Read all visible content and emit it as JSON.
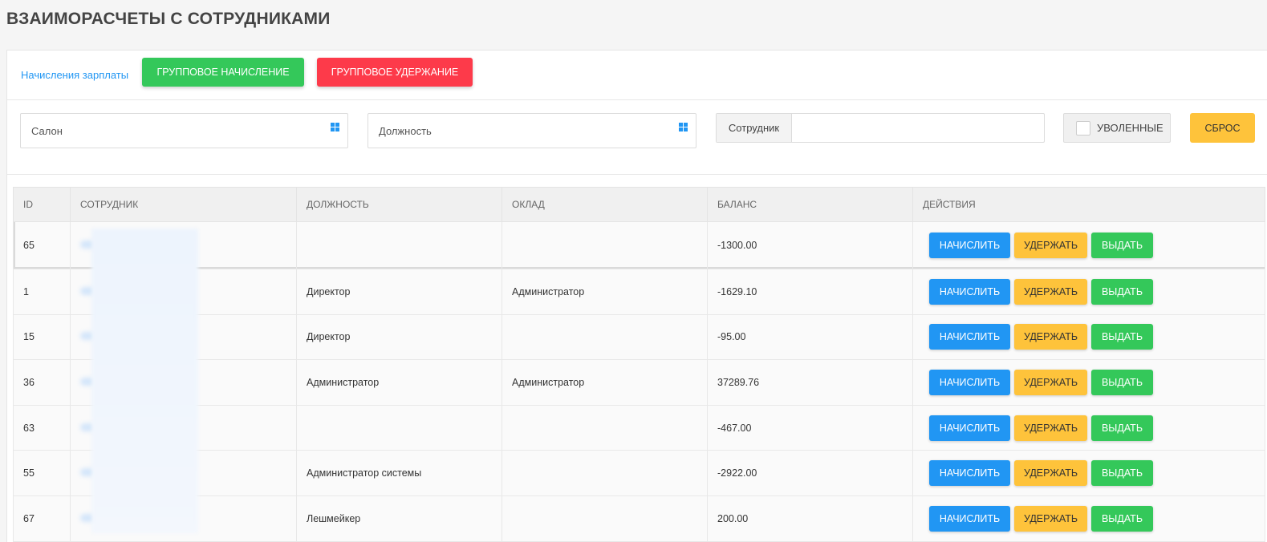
{
  "page": {
    "title": "ВЗАИМОРАСЧЕТЫ С СОТРУДНИКАМИ"
  },
  "toolbar": {
    "salary_link": "Начисления зарплаты",
    "group_accrual": "ГРУППОВОЕ НАЧИСЛЕНИЕ",
    "group_deduction": "ГРУППОВОЕ УДЕРЖАНИЕ"
  },
  "filters": {
    "salon_placeholder": "Салон",
    "position_placeholder": "Должность",
    "employee_label": "Сотрудник",
    "employee_value": "",
    "fired_label": "УВОЛЕННЫЕ",
    "fired_checked": false,
    "reset_label": "СБРОС"
  },
  "colors": {
    "accent_blue": "#2196f3",
    "green": "#34c85a",
    "red": "#fd3a4a",
    "yellow": "#fec33b"
  },
  "table": {
    "headers": [
      "ID",
      "СОТРУДНИК",
      "ДОЛЖНОСТЬ",
      "ОКЛАД",
      "БАЛАНС",
      "ДЕЙСТВИЯ"
    ],
    "actions": {
      "accrue": "НАЧИСЛИТЬ",
      "deduct": "УДЕРЖАТЬ",
      "pay": "ВЫДАТЬ"
    },
    "rows": [
      {
        "id": "65",
        "position": "",
        "salary": "",
        "balance": "-1300.00"
      },
      {
        "id": "1",
        "position": "Директор",
        "salary": "Администратор",
        "balance": "-1629.10"
      },
      {
        "id": "15",
        "position": "Директор",
        "salary": "",
        "balance": "-95.00"
      },
      {
        "id": "36",
        "position": "Администратор",
        "salary": "Администратор",
        "balance": "37289.76"
      },
      {
        "id": "63",
        "position": "",
        "salary": "",
        "balance": "-467.00"
      },
      {
        "id": "55",
        "position": "Администратор системы",
        "salary": "",
        "balance": "-2922.00"
      },
      {
        "id": "67",
        "position": "Лешмейкер",
        "salary": "",
        "balance": "200.00"
      }
    ]
  }
}
